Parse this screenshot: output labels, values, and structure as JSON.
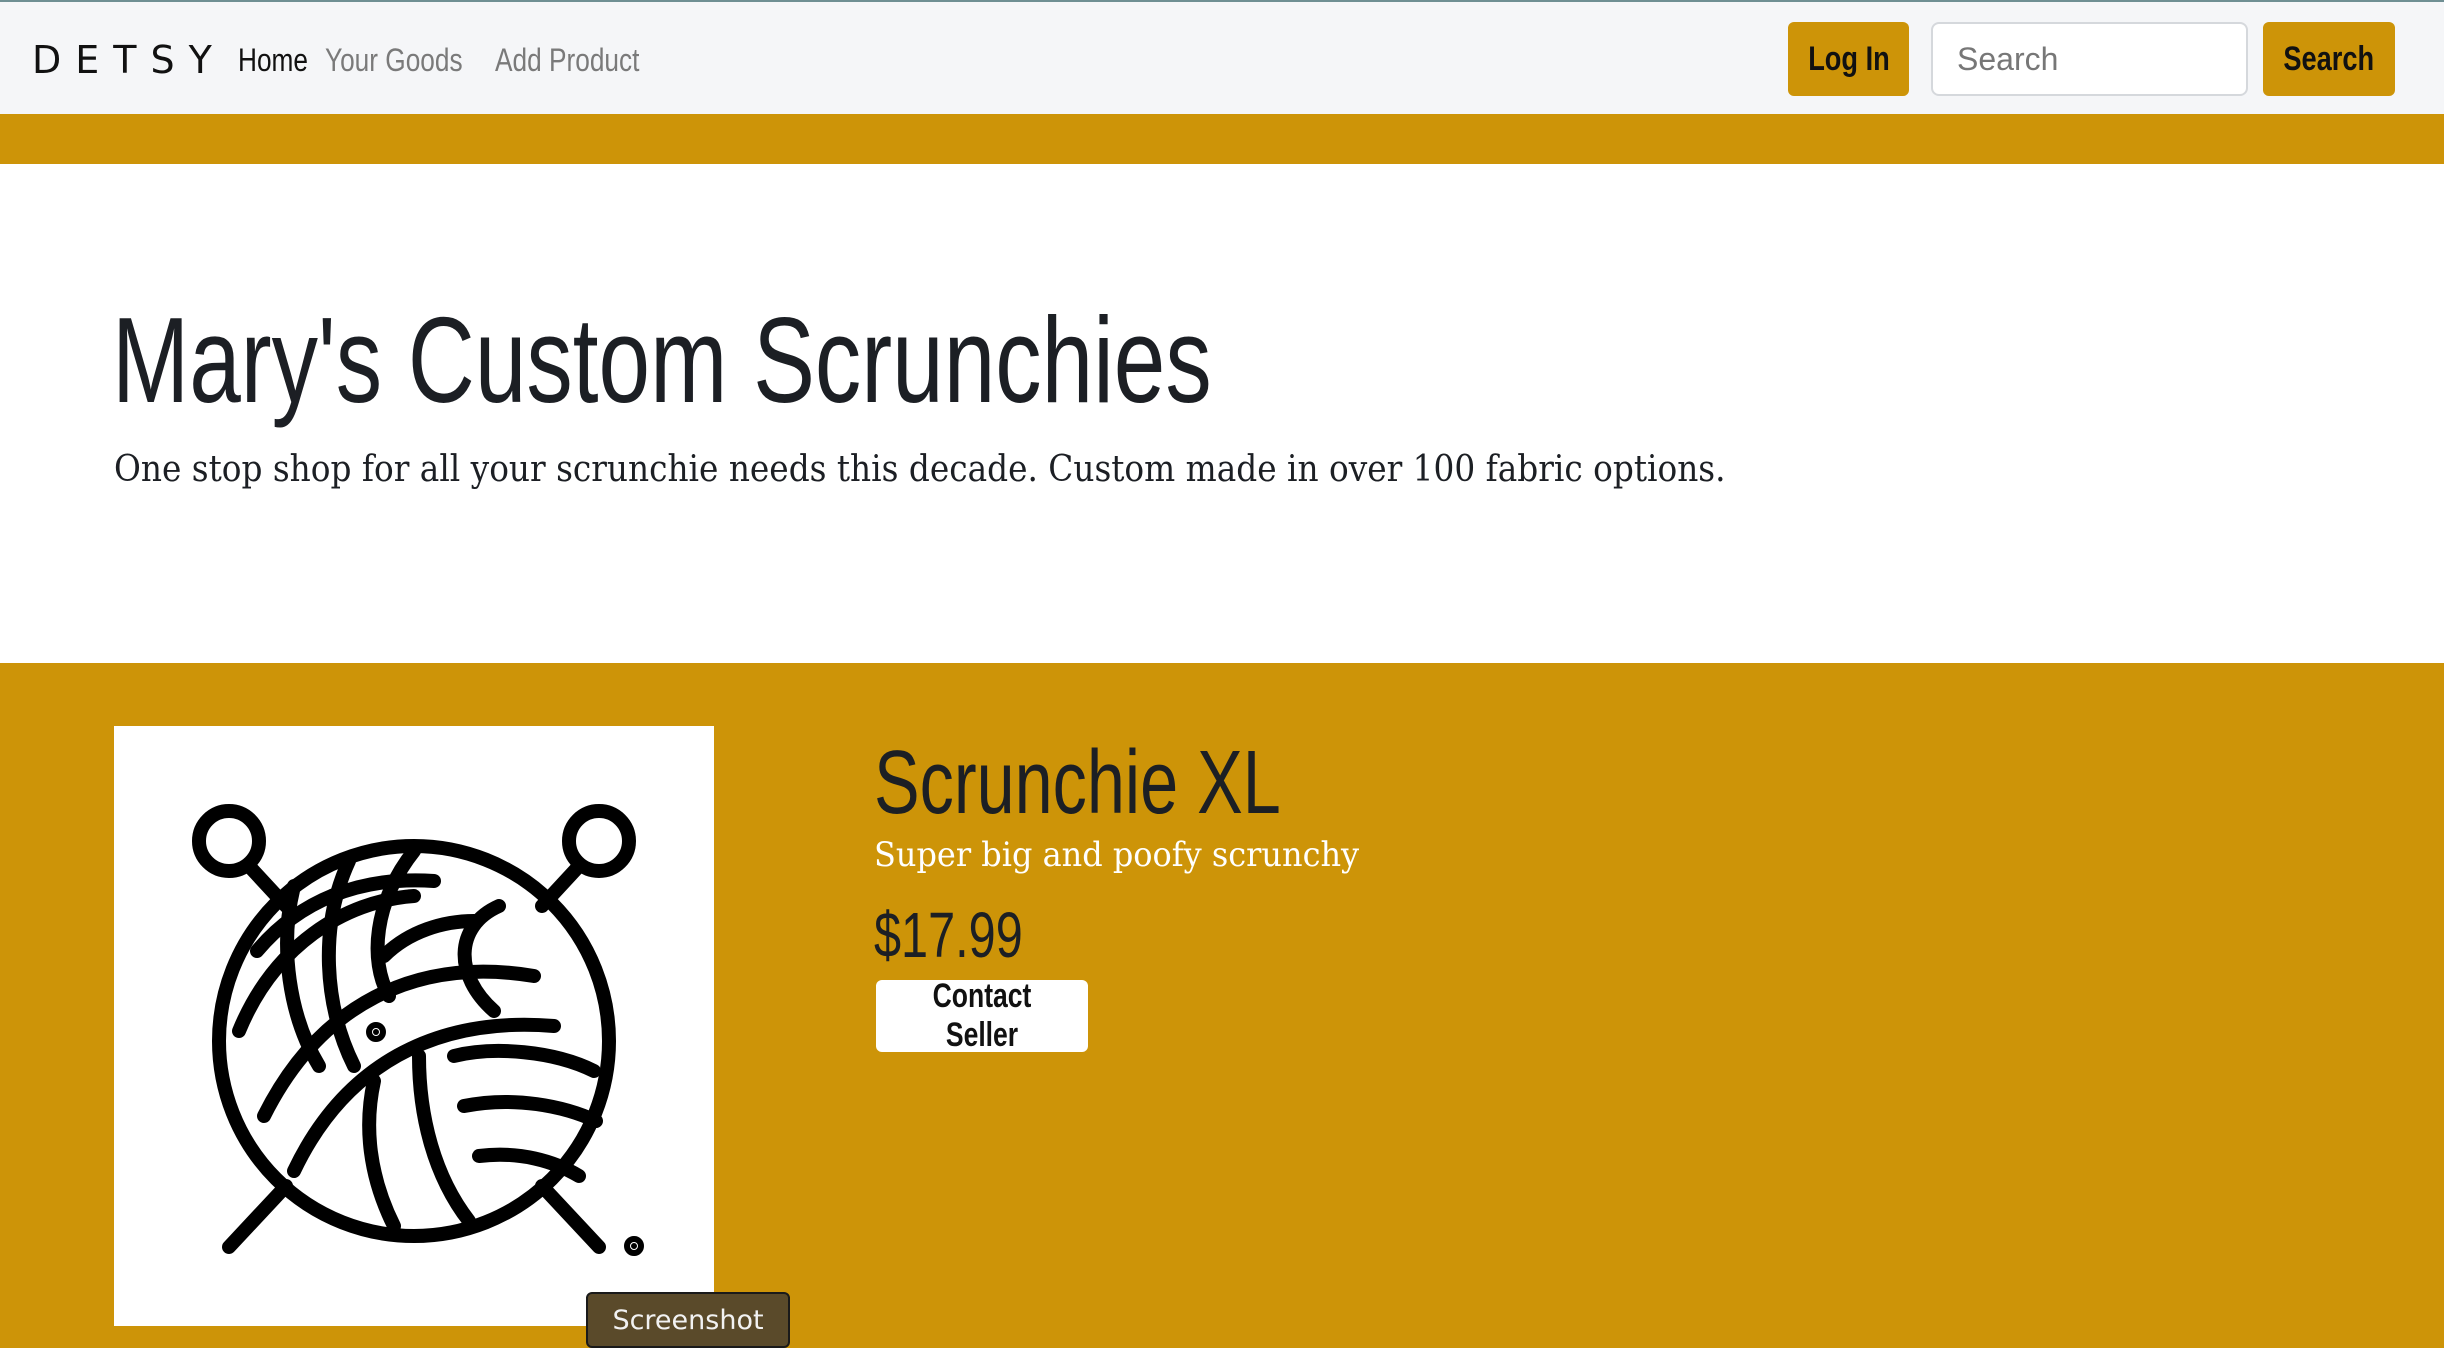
{
  "navbar": {
    "brand": "DETSY",
    "links": [
      {
        "label": "Home",
        "active": true
      },
      {
        "label": "Your Goods",
        "active": false
      },
      {
        "label": "Add Product",
        "active": false
      }
    ],
    "login_label": "Log In",
    "search_placeholder": "Search",
    "search_button_label": "Search"
  },
  "hero": {
    "title": "Mary's Custom Scrunchies",
    "subtitle": "One stop shop for all your scrunchie needs this decade. Custom made in over 100 fabric options."
  },
  "product": {
    "image_icon": "yarn-ball-with-needles-icon",
    "name": "Scrunchie XL",
    "description": "Super big and poofy scrunchy",
    "price": "$17.99",
    "contact_label": "Contact Seller"
  },
  "tooltip": {
    "label": "Screenshot"
  },
  "colors": {
    "accent": "#cd9408",
    "navbar_bg": "#f5f6f8",
    "text_dark": "#1c1f24",
    "white": "#ffffff"
  }
}
